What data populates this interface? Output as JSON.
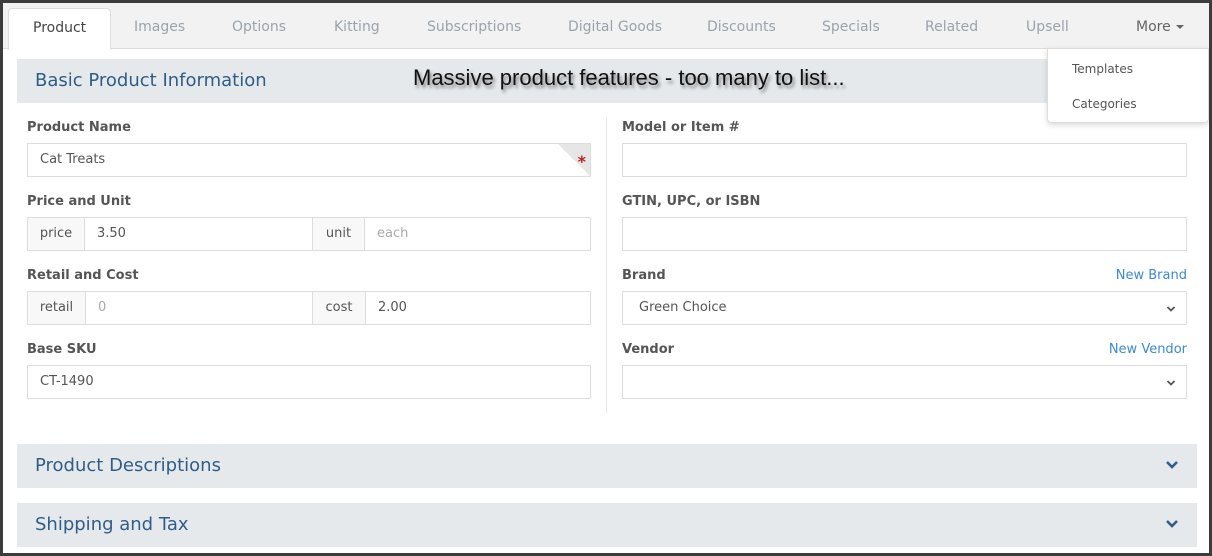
{
  "tabs": [
    {
      "label": "Product",
      "active": true
    },
    {
      "label": "Images"
    },
    {
      "label": "Options"
    },
    {
      "label": "Kitting"
    },
    {
      "label": "Subscriptions"
    },
    {
      "label": "Digital Goods"
    },
    {
      "label": "Discounts"
    },
    {
      "label": "Specials"
    },
    {
      "label": "Related"
    },
    {
      "label": "Upsell"
    },
    {
      "label": "More"
    }
  ],
  "more_menu": {
    "items": [
      "Templates",
      "Categories"
    ]
  },
  "banner": "Massive product features - too many to list...",
  "sections": {
    "basic": {
      "title": "Basic Product Information"
    },
    "descriptions": {
      "title": "Product Descriptions"
    },
    "shipping": {
      "title": "Shipping and Tax"
    }
  },
  "form": {
    "product_name": {
      "label": "Product Name",
      "value": "Cat Treats",
      "required_mark": "*"
    },
    "price_unit": {
      "label": "Price and Unit",
      "price_addon": "price",
      "price_value": "3.50",
      "unit_addon": "unit",
      "unit_placeholder": "each"
    },
    "retail_cost": {
      "label": "Retail and Cost",
      "retail_addon": "retail",
      "retail_placeholder": "0",
      "cost_addon": "cost",
      "cost_value": "2.00"
    },
    "base_sku": {
      "label": "Base SKU",
      "value": "CT-1490"
    },
    "model": {
      "label": "Model or Item #",
      "value": ""
    },
    "gtin": {
      "label": "GTIN, UPC, or ISBN",
      "value": ""
    },
    "brand": {
      "label": "Brand",
      "link": "New Brand",
      "selected": "Green Choice"
    },
    "vendor": {
      "label": "Vendor",
      "link": "New Vendor",
      "selected": ""
    }
  },
  "colors": {
    "accent_link": "#3a8ccc",
    "section_title": "#2f5d87",
    "section_bg": "#e6e9ec",
    "required": "#bb2222"
  }
}
